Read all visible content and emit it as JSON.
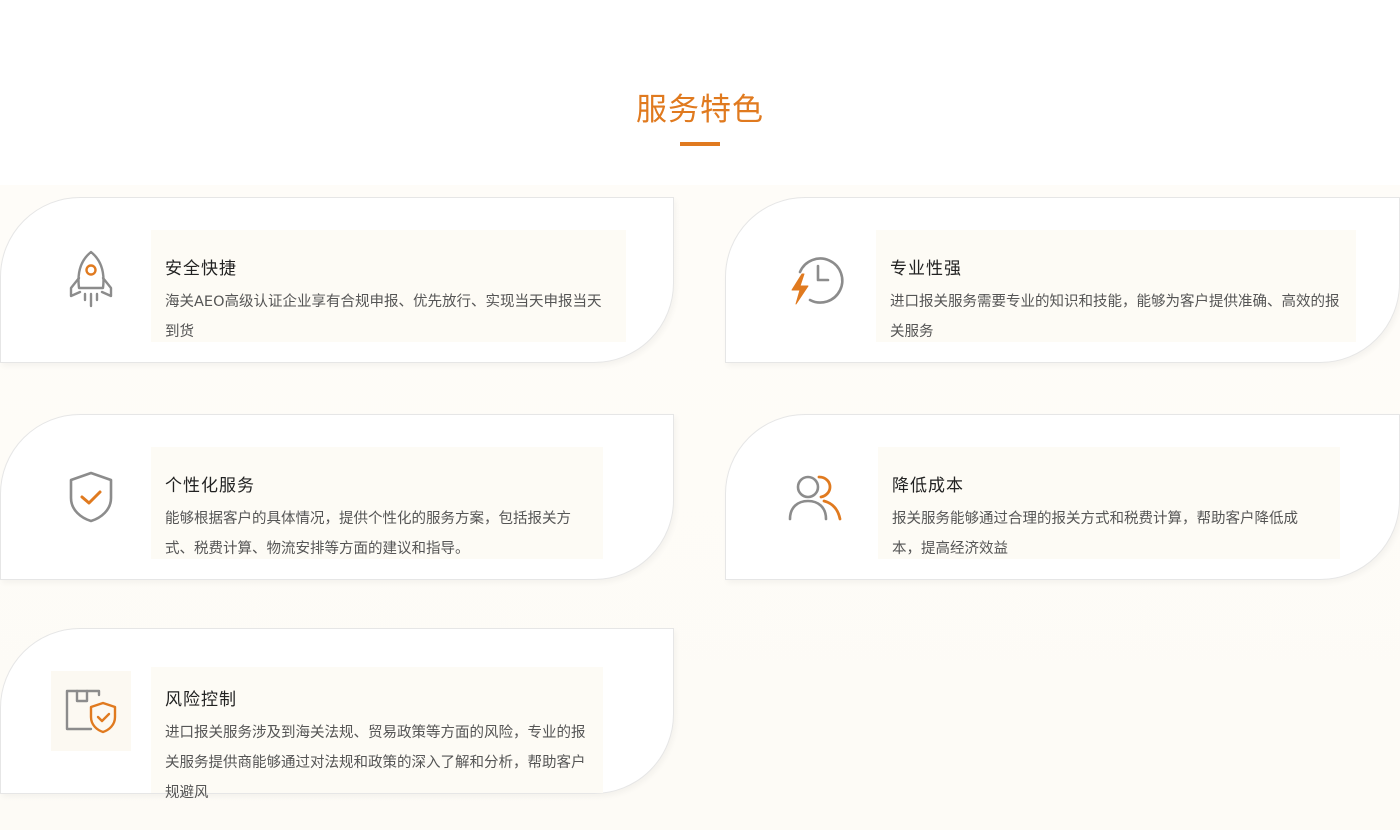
{
  "section": {
    "title": "服务特色"
  },
  "colors": {
    "accent": "#e07a1f",
    "icon_gray": "#8c8c8c"
  },
  "cards": [
    {
      "icon": "rocket-icon",
      "title": "安全快捷",
      "desc": "海关AEO高级认证企业享有合规申报、优先放行、实现当天申报当天到货"
    },
    {
      "icon": "clock-lightning-icon",
      "title": "专业性强",
      "desc": "进口报关服务需要专业的知识和技能，能够为客户提供准确、高效的报关服务"
    },
    {
      "icon": "shield-check-icon",
      "title": "个性化服务",
      "desc": "能够根据客户的具体情况，提供个性化的服务方案，包括报关方式、税费计算、物流安排等方面的建议和指导。"
    },
    {
      "icon": "users-icon",
      "title": "降低成本",
      "desc": "报关服务能够通过合理的报关方式和税费计算，帮助客户降低成本，提高经济效益"
    },
    {
      "icon": "box-shield-icon",
      "title": "风险控制",
      "desc": "进口报关服务涉及到海关法规、贸易政策等方面的风险，专业的报关服务提供商能够通过对法规和政策的深入了解和分析，帮助客户规避风"
    }
  ]
}
